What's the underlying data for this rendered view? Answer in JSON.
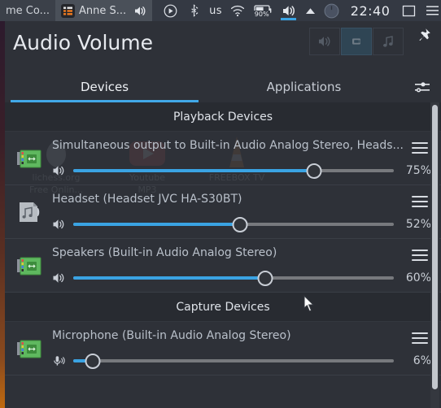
{
  "panel": {
    "tasks": [
      {
        "label": "me Co...",
        "state": "inactive",
        "icon": "window-icon"
      },
      {
        "label": "Anne S...",
        "state": "active",
        "icon": "list-icon"
      }
    ],
    "task_volume_icon": "speaker-icon",
    "tray": {
      "media_icon": "play-circle-icon",
      "bluetooth_icon": "bluetooth-icon",
      "keyboard_layout": "us",
      "wifi_icon": "wifi-icon",
      "battery_icon": "battery-icon",
      "battery_percent": "90%",
      "volume_icon": "speaker-icon",
      "chevron_icon": "chevron-up-icon",
      "knob_icon": "circle-knob-icon",
      "clock": "22:40",
      "workspace_icon": "workspace-square-icon",
      "menu_icon": "hamburger-menu-icon"
    }
  },
  "window": {
    "title": "Audio Volume",
    "pin_icon": "pin-icon",
    "mode_buttons": [
      {
        "name": "output-mode",
        "icon": "speaker-icon",
        "selected": false
      },
      {
        "name": "input-mode",
        "icon": "microphone-icon",
        "selected": true
      },
      {
        "name": "media-mode",
        "icon": "music-note-icon",
        "selected": false
      }
    ],
    "tabs": [
      {
        "label": "Devices",
        "active": true
      },
      {
        "label": "Applications",
        "active": false
      }
    ],
    "settings_icon": "sliders-settings-icon"
  },
  "sections": [
    {
      "title": "Playback Devices",
      "devices": [
        {
          "name": "Simultaneous output to Built-in Audio Analog Stereo, Heads...",
          "icon": "soundcard-icon",
          "mute_icon": "speaker-icon",
          "volume": 75,
          "volume_label": "75%",
          "menu_icon": "hamburger-menu-icon"
        },
        {
          "name": "Headset (Headset JVC HA-S30BT)",
          "icon": "audio-file-icon",
          "mute_icon": "speaker-icon",
          "volume": 52,
          "volume_label": "52%",
          "menu_icon": "hamburger-menu-icon"
        },
        {
          "name": "Speakers (Built-in Audio Analog Stereo)",
          "icon": "soundcard-icon",
          "mute_icon": "speaker-icon",
          "volume": 60,
          "volume_label": "60%",
          "menu_icon": "hamburger-menu-icon"
        }
      ]
    },
    {
      "title": "Capture Devices",
      "devices": [
        {
          "name": "Microphone (Built-in Audio Analog Stereo)",
          "icon": "soundcard-icon",
          "mute_icon": "microphone-icon",
          "volume": 6,
          "volume_label": "6%",
          "menu_icon": "hamburger-menu-icon"
        }
      ]
    }
  ],
  "desktop_ghost_labels": [
    "lichess.org",
    "Free Onlin...",
    "Youtube",
    "MP3",
    "FREEBOX TV"
  ],
  "colors": {
    "accent": "#3aa3e3",
    "window_bg": "#2e3138",
    "section_bg": "#282b31",
    "panel_bg": "#3b4049",
    "text": "#dfe3e9"
  }
}
